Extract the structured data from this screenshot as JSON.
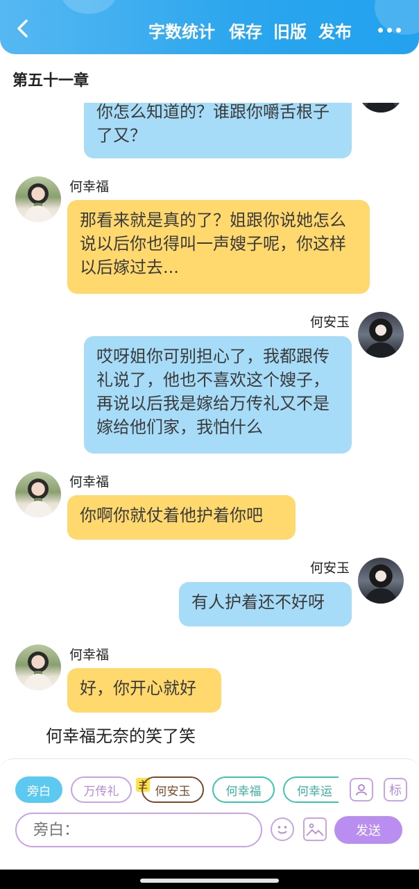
{
  "header": {
    "back_icon": "chevron-left-icon",
    "word_count_label": "字数统计",
    "save_label": "保存",
    "old_version_label": "旧版",
    "publish_label": "发布",
    "more_icon": "more-dots-icon",
    "color": "#2aa5ee"
  },
  "chapter_title": "第五十一章",
  "messages": [
    {
      "speaker": "",
      "side": "right",
      "text": "你怎么知道的？谁跟你嚼舌根子了又？",
      "color": "#a6dcf8"
    },
    {
      "speaker": "何幸福",
      "side": "left",
      "text": "那看来就是真的了？姐跟你说她怎么说以后你也得叫一声嫂子呢，你这样以后嫁过去...",
      "color": "#ffd96d"
    },
    {
      "speaker": "何安玉",
      "side": "right",
      "text": "哎呀姐你可别担心了，我都跟传礼说了，他也不喜欢这个嫂子，再说以后我是嫁给万传礼又不是嫁给他们家，我怕什么",
      "color": "#a6dcf8"
    },
    {
      "speaker": "何幸福",
      "side": "left",
      "text": "你啊你就仗着他护着你吧",
      "color": "#ffd96d"
    },
    {
      "speaker": "何安玉",
      "side": "right",
      "text": "有人护着还不好呀",
      "color": "#a6dcf8"
    },
    {
      "speaker": "何幸福",
      "side": "left",
      "text": "好，你开心就好",
      "color": "#ffd96d"
    }
  ],
  "narration": "何幸福无奈的笑了笑",
  "roles": {
    "chips": [
      {
        "label": "旁白",
        "active": true
      },
      {
        "label": "万传礼"
      },
      {
        "label": "何安玉",
        "badge": "主"
      },
      {
        "label": "何幸福"
      },
      {
        "label": "何幸运"
      }
    ],
    "avatar_tool_icon": "person-icon",
    "tag_tool_label": "标"
  },
  "input": {
    "placeholder": "旁白："
  },
  "emoji_icon": "smiley-icon",
  "image_icon": "image-icon",
  "send_label": "发送"
}
